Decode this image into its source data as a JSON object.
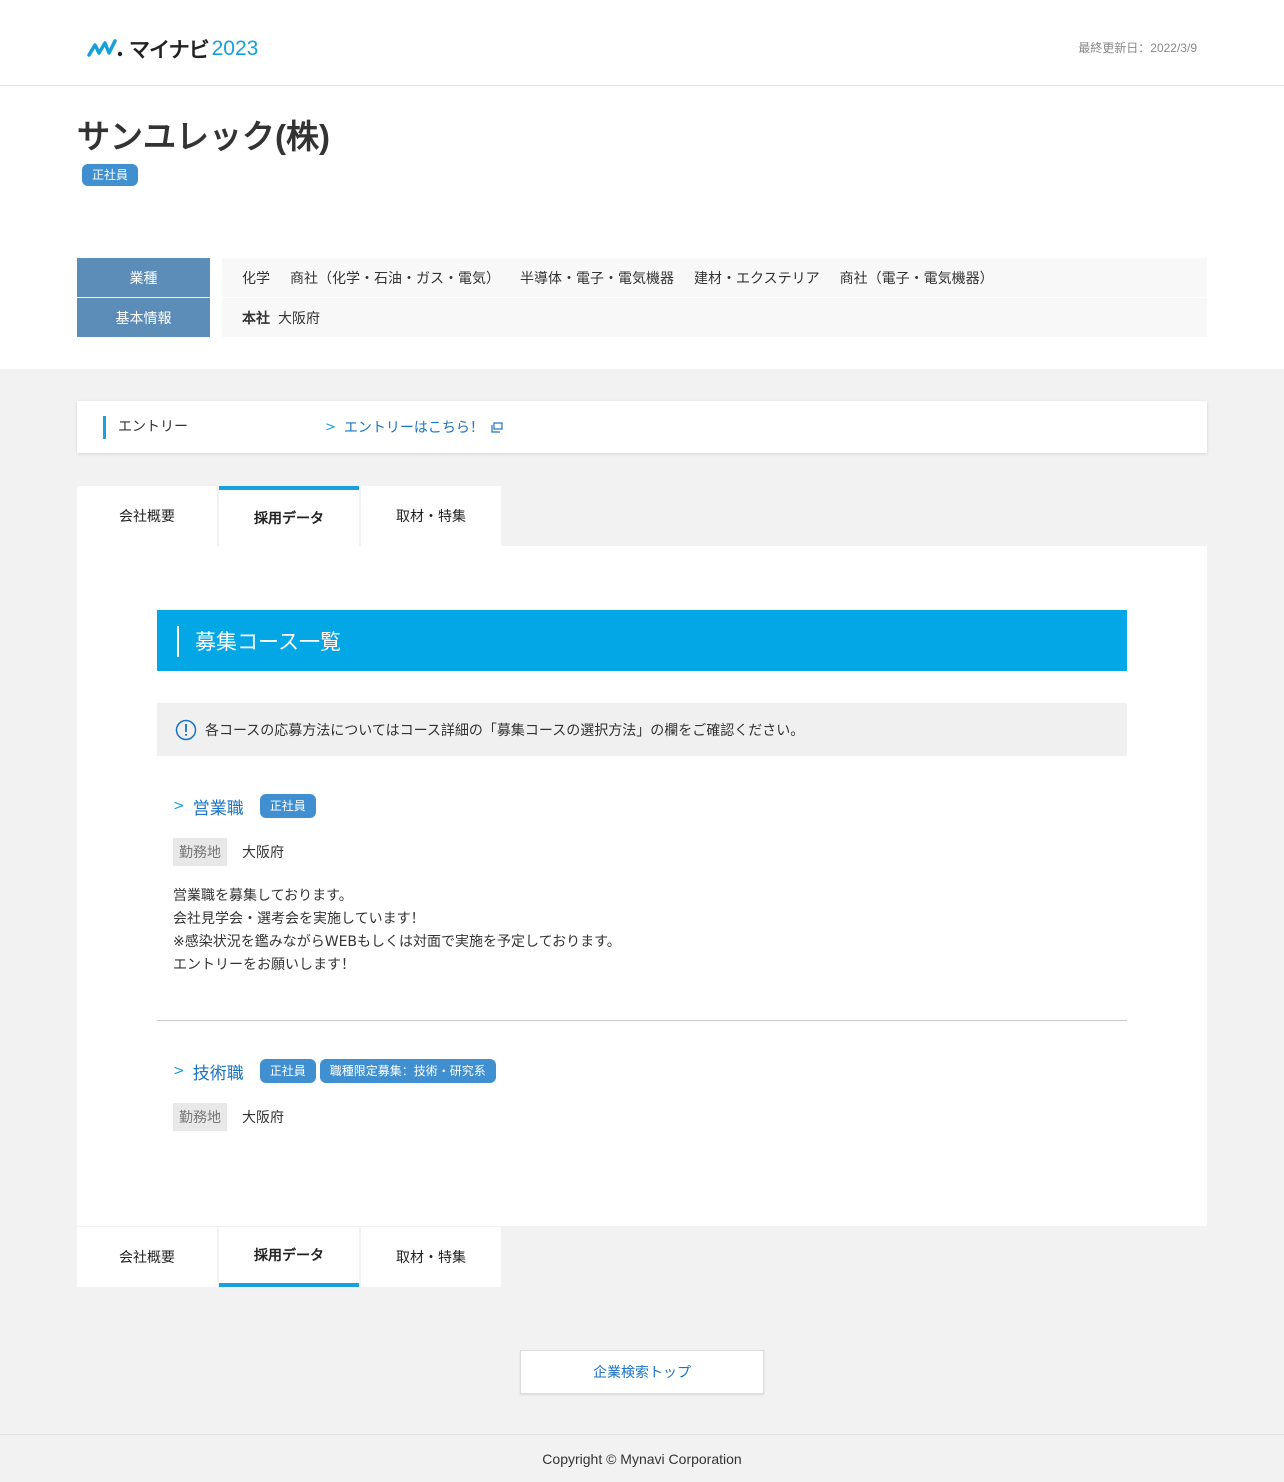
{
  "header": {
    "logo_text": "マイナビ",
    "logo_year": "2023",
    "last_updated": "最終更新日：2022/3/9"
  },
  "company": {
    "name": "サンユレック(株)",
    "employment_badge": "正社員"
  },
  "info": {
    "industry_label": "業種",
    "industries": [
      "化学",
      "商社（化学・石油・ガス・電気）",
      "半導体・電子・電気機器",
      "建材・エクステリア",
      "商社（電子・電気機器）"
    ],
    "basic_label": "基本情報",
    "hq_label": "本社",
    "hq_value": "大阪府"
  },
  "entry": {
    "label": "エントリー",
    "link_text": "エントリーはこちら！"
  },
  "tabs": [
    {
      "label": "会社概要",
      "active": false
    },
    {
      "label": "採用データ",
      "active": true
    },
    {
      "label": "取材・特集",
      "active": false
    }
  ],
  "panel": {
    "section_title": "募集コース一覧",
    "notice": "各コースの応募方法についてはコース詳細の「募集コースの選択方法」の欄をご確認ください。",
    "courses": [
      {
        "name": "営業職",
        "badges": [
          "正社員"
        ],
        "location_label": "勤務地",
        "location": "大阪府",
        "description": [
          "営業職を募集しております。",
          "会社見学会・選考会を実施しています！",
          "※感染状況を鑑みながらWEBもしくは対面で実施を予定しております。",
          "エントリーをお願いします！"
        ]
      },
      {
        "name": "技術職",
        "badges": [
          "正社員",
          "職種限定募集：技術・研究系"
        ],
        "location_label": "勤務地",
        "location": "大阪府"
      }
    ]
  },
  "search_top_button": "企業検索トップ",
  "footer": "Copyright © Mynavi Corporation",
  "colors": {
    "accent": "#03a7e6",
    "badge": "#3f8fd1",
    "table_head": "#5c8db8",
    "link": "#1a73c4"
  }
}
